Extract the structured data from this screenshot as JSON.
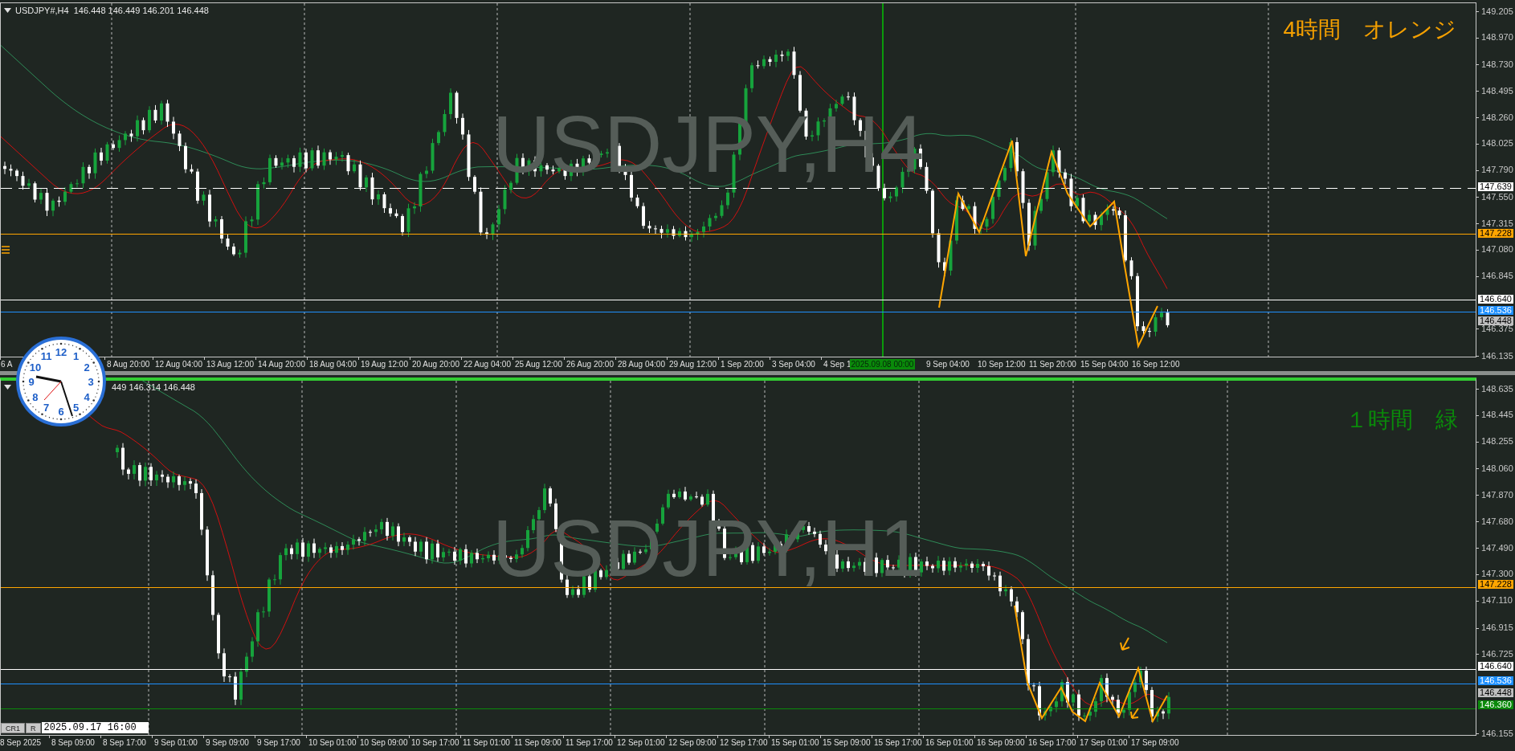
{
  "panels": [
    {
      "title": "USDJPY#,H4  146.448 146.449 146.201 146.448",
      "watermark": "USDJPY,H4",
      "note": "4時間　オレンジ",
      "price_ticks": [
        "149.205",
        "148.970",
        "148.730",
        "148.495",
        "148.260",
        "148.025",
        "147.790",
        "147.550",
        "147.315",
        "147.080",
        "146.845",
        "146.375",
        "146.135"
      ],
      "price_markers": [
        {
          "value": "147.639",
          "color": "#ffffff",
          "kind": "dashed"
        },
        {
          "value": "147.228",
          "color": "#ffa500",
          "kind": "solid"
        },
        {
          "value": "146.640",
          "color": "#ffffff",
          "kind": "solid"
        },
        {
          "value": "146.536",
          "color": "#1e90ff",
          "kind": "solid"
        },
        {
          "value": "146.448",
          "color": "#c0c0c0",
          "kind": "label"
        }
      ],
      "time_labels": [
        "6 A",
        "8 Aug 20:00",
        "12 Aug 04:00",
        "13 Aug 12:00",
        "14 Aug 20:00",
        "18 Aug 04:00",
        "19 Aug 12:00",
        "20 Aug 20:00",
        "22 Aug 04:00",
        "25 Aug 12:00",
        "26 Aug 20:00",
        "28 Aug 04:00",
        "29 Aug 12:00",
        "1 Sep 20:00",
        "3 Sep 04:00",
        "4 Sep 1"
      ],
      "time_labels_after": [
        "9 Sep 04:00",
        "10 Sep 12:00",
        "11 Sep 20:00",
        "15 Sep 04:00",
        "16 Sep 12:00"
      ],
      "time_cursor": "2025.09.08 00:00"
    },
    {
      "title": "449 146.314 146.448",
      "watermark": "USDJPY,H1",
      "note": "１時間　緑",
      "price_ticks": [
        "148.635",
        "148.445",
        "148.255",
        "148.060",
        "147.870",
        "147.680",
        "147.490",
        "147.300",
        "147.110",
        "146.915",
        "146.725",
        "146.155"
      ],
      "price_markers": [
        {
          "value": "147.228",
          "color": "#ffa500",
          "kind": "solid"
        },
        {
          "value": "146.640",
          "color": "#ffffff",
          "kind": "solid"
        },
        {
          "value": "146.536",
          "color": "#1e90ff",
          "kind": "solid"
        },
        {
          "value": "146.448",
          "color": "#c0c0c0",
          "kind": "label"
        },
        {
          "value": "146.360",
          "color": "#0a8a0a",
          "kind": "solid"
        }
      ],
      "time_labels": [
        "8 Sep 2025",
        "8 Sep 09:00",
        "8 Sep 17:00",
        "9 Sep 01:00",
        "9 Sep 09:00",
        "9 Sep 17:00",
        "10 Sep 01:00",
        "10 Sep 09:00",
        "10 Sep 17:00",
        "11 Sep 01:00",
        "11 Sep 09:00",
        "11 Sep 17:00",
        "12 Sep 01:00",
        "12 Sep 09:00",
        "12 Sep 17:00",
        "15 Sep 01:00",
        "15 Sep 09:00",
        "15 Sep 17:00",
        "16 Sep 01:00",
        "16 Sep 09:00",
        "16 Sep 17:00",
        "17 Sep 01:00",
        "17 Sep 09:00"
      ]
    }
  ],
  "clock": {
    "numerals": [
      "12",
      "11",
      "1",
      "10",
      "2",
      "9",
      "3",
      "8",
      "4",
      "7",
      "5",
      "6"
    ]
  },
  "time_box": {
    "buttons": [
      "CR1",
      "R"
    ],
    "value": "2025.09.17 16:00"
  }
}
